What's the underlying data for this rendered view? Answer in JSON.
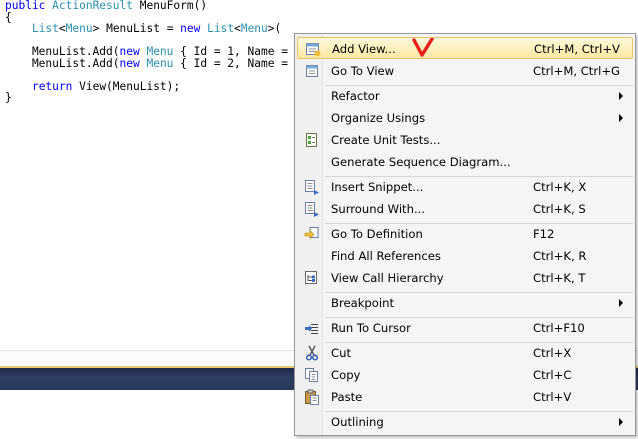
{
  "editor": {
    "lines": [
      [
        {
          "t": "public ",
          "c": "kw"
        },
        {
          "t": "ActionResult",
          "c": "ty"
        },
        {
          "t": " MenuForm()",
          "c": ""
        }
      ],
      [
        {
          "t": "{",
          "c": ""
        }
      ],
      [
        {
          "t": "    ",
          "c": ""
        },
        {
          "t": "List",
          "c": "ty"
        },
        {
          "t": "<",
          "c": ""
        },
        {
          "t": "Menu",
          "c": "ty"
        },
        {
          "t": "> MenuList = ",
          "c": ""
        },
        {
          "t": "new ",
          "c": "kw"
        },
        {
          "t": "List",
          "c": "ty"
        },
        {
          "t": "<",
          "c": ""
        },
        {
          "t": "Menu",
          "c": "ty"
        },
        {
          "t": ">(",
          "c": ""
        }
      ],
      [
        {
          "t": "",
          "c": ""
        }
      ],
      [
        {
          "t": "    MenuList.Add(",
          "c": ""
        },
        {
          "t": "new ",
          "c": "kw"
        },
        {
          "t": "Menu",
          "c": "ty"
        },
        {
          "t": " { Id = 1, Name =",
          "c": ""
        }
      ],
      [
        {
          "t": "    MenuList.Add(",
          "c": ""
        },
        {
          "t": "new ",
          "c": "kw"
        },
        {
          "t": "Menu",
          "c": "ty"
        },
        {
          "t": " { Id = 2, Name =",
          "c": ""
        }
      ],
      [
        {
          "t": "",
          "c": ""
        }
      ],
      [
        {
          "t": "    ",
          "c": ""
        },
        {
          "t": "return ",
          "c": "kw"
        },
        {
          "t": "View(MenuList);",
          "c": ""
        }
      ],
      [
        {
          "t": "}",
          "c": ""
        }
      ]
    ]
  },
  "menu": {
    "items": [
      {
        "label": "Add View...",
        "shortcut": "Ctrl+M, Ctrl+V",
        "icon": "add-view-icon",
        "selected": true
      },
      {
        "label": "Go To View",
        "shortcut": "Ctrl+M, Ctrl+G",
        "icon": "go-to-view-icon"
      },
      {
        "label": "Refactor",
        "shortcut": "",
        "submenu": true
      },
      {
        "label": "Organize Usings",
        "shortcut": "",
        "submenu": true
      },
      {
        "label": "Create Unit Tests...",
        "shortcut": "",
        "icon": "unit-test-icon"
      },
      {
        "label": "Generate Sequence Diagram...",
        "shortcut": ""
      },
      {
        "label": "Insert Snippet...",
        "shortcut": "Ctrl+K, X",
        "icon": "insert-snippet-icon"
      },
      {
        "label": "Surround With...",
        "shortcut": "Ctrl+K, S",
        "icon": "surround-with-icon"
      },
      {
        "label": "Go To Definition",
        "shortcut": "F12",
        "icon": "go-to-definition-icon"
      },
      {
        "label": "Find All References",
        "shortcut": "Ctrl+K, R"
      },
      {
        "label": "View Call Hierarchy",
        "shortcut": "Ctrl+K, T",
        "icon": "call-hierarchy-icon"
      },
      {
        "label": "Breakpoint",
        "shortcut": "",
        "submenu": true
      },
      {
        "label": "Run To Cursor",
        "shortcut": "Ctrl+F10",
        "icon": "run-to-cursor-icon"
      },
      {
        "label": "Cut",
        "shortcut": "Ctrl+X",
        "icon": "cut-icon"
      },
      {
        "label": "Copy",
        "shortcut": "Ctrl+C",
        "icon": "copy-icon"
      },
      {
        "label": "Paste",
        "shortcut": "Ctrl+V",
        "icon": "paste-icon"
      },
      {
        "label": "Outlining",
        "shortcut": "",
        "submenu": true
      }
    ]
  },
  "annotation": {
    "icon": "red-check-mark-icon",
    "color": "#e8201c"
  }
}
